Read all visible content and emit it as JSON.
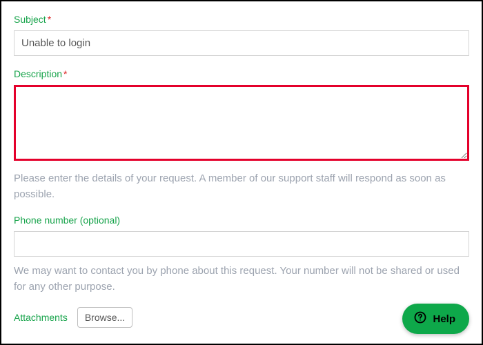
{
  "subject": {
    "label": "Subject",
    "required_mark": "*",
    "value": "Unable to login"
  },
  "description": {
    "label": "Description",
    "required_mark": "*",
    "value": "",
    "hint": "Please enter the details of your request. A member of our support staff will respond as soon as possible."
  },
  "phone": {
    "label": "Phone number (optional)",
    "value": "",
    "hint": "We may want to contact you by phone about this request. Your number will not be shared or used for any other purpose."
  },
  "attachments": {
    "label": "Attachments",
    "browse_label": "Browse..."
  },
  "help_widget": {
    "label": "Help"
  }
}
